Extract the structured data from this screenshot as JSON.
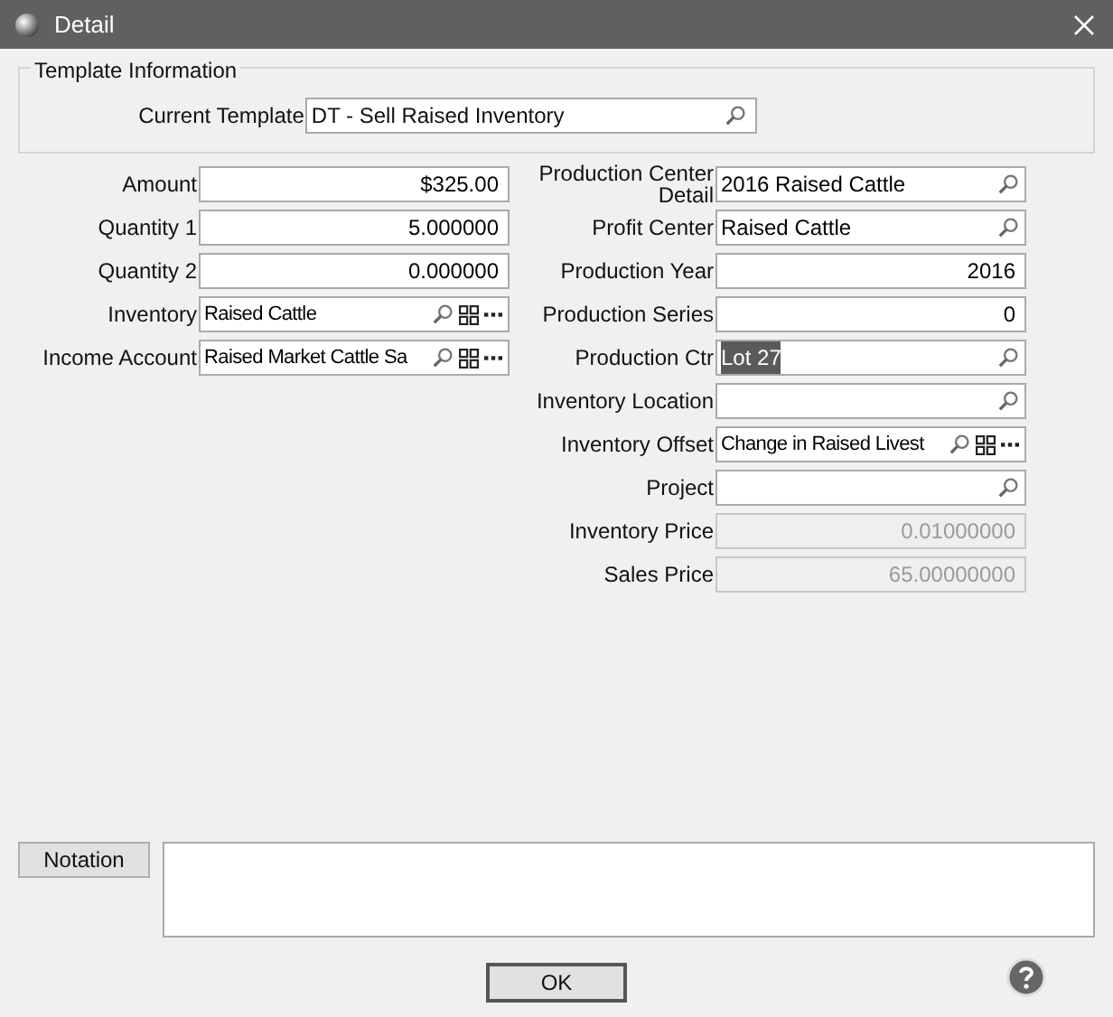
{
  "window": {
    "title": "Detail"
  },
  "template": {
    "legend": "Template Information",
    "label": "Current Template",
    "value": "DT - Sell Raised Inventory"
  },
  "left_fields": [
    {
      "label": "Amount",
      "value": "$325.00",
      "kind": "number",
      "disabled": false,
      "highlighted": false
    },
    {
      "label": "Quantity 1",
      "value": "5.000000",
      "kind": "number",
      "disabled": false,
      "highlighted": false
    },
    {
      "label": "Quantity 2",
      "value": "0.000000",
      "kind": "number",
      "disabled": false,
      "highlighted": false
    },
    {
      "label": "Inventory",
      "value": "Raised Cattle",
      "kind": "account",
      "disabled": false,
      "highlighted": false
    },
    {
      "label": "Income Account",
      "value": "Raised Market Cattle Sa",
      "kind": "account",
      "disabled": false,
      "highlighted": false
    }
  ],
  "right_fields": [
    {
      "label": "Production Center Detail",
      "value": "2016 Raised Cattle",
      "kind": "lookup",
      "disabled": false,
      "highlighted": false
    },
    {
      "label": "Profit Center",
      "value": "Raised Cattle",
      "kind": "lookup",
      "disabled": false,
      "highlighted": false
    },
    {
      "label": "Production Year",
      "value": "2016",
      "kind": "number",
      "disabled": false,
      "highlighted": false
    },
    {
      "label": "Production Series",
      "value": "0",
      "kind": "number",
      "disabled": false,
      "highlighted": false
    },
    {
      "label": "Production Ctr",
      "value": "Lot 27",
      "kind": "lookup",
      "disabled": false,
      "highlighted": true
    },
    {
      "label": "Inventory Location",
      "kind": "lookup",
      "disabled": false
    },
    {
      "label": "Inventory Offset",
      "value": "Change in Raised Livest",
      "kind": "account",
      "disabled": false,
      "highlighted": false
    },
    {
      "label": "Project",
      "kind": "lookup",
      "disabled": false
    },
    {
      "label": "Inventory Price",
      "value": "0.01000000",
      "kind": "number",
      "disabled": true,
      "highlighted": false
    },
    {
      "label": "Sales Price",
      "value": "65.00000000",
      "kind": "number",
      "disabled": true,
      "highlighted": false
    }
  ],
  "notation": {
    "button": "Notation"
  },
  "buttons": [
    "OK"
  ]
}
